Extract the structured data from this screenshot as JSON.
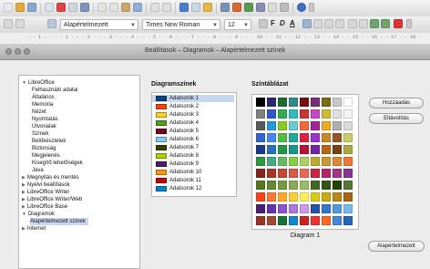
{
  "toolbar": {
    "paragraph_style": "Alapértelmezett",
    "font_name": "Times New Roman",
    "font_size": "12",
    "format_labels": [
      "F",
      "D",
      "A"
    ]
  },
  "ruler": {
    "text": "· · 1 · · · · 1 · · · 2 · · · 3 · · · 4 · · · 5 · · 6 · · · 7 · · · 8 · · · 9 · · · 10 · · 11 · · 12 · · 13 · · 14 · · 15 · · 16 · · 17 · · 18 ·"
  },
  "dialog": {
    "title": "Beállítások – Diagramok – Alapértelmezett színek",
    "tree": [
      {
        "label": "LibreOffice",
        "level": 0,
        "twisty": "▼",
        "selected": false
      },
      {
        "label": "Felhasználó adatai",
        "level": 1,
        "selected": false
      },
      {
        "label": "Általános",
        "level": 1,
        "selected": false
      },
      {
        "label": "Memória",
        "level": 1,
        "selected": false
      },
      {
        "label": "Nézet",
        "level": 1,
        "selected": false
      },
      {
        "label": "Nyomtatás",
        "level": 1,
        "selected": false
      },
      {
        "label": "Útvonalak",
        "level": 1,
        "selected": false
      },
      {
        "label": "Színek",
        "level": 1,
        "selected": false
      },
      {
        "label": "Betűkészletek",
        "level": 1,
        "selected": false
      },
      {
        "label": "Biztonság",
        "level": 1,
        "selected": false
      },
      {
        "label": "Megjelenés",
        "level": 1,
        "selected": false
      },
      {
        "label": "Kisegítő lehetőségek",
        "level": 1,
        "selected": false
      },
      {
        "label": "Java",
        "level": 1,
        "selected": false
      },
      {
        "label": "Megnyitás és mentés",
        "level": 0,
        "twisty": "▶",
        "selected": false
      },
      {
        "label": "Nyelvi beállítások",
        "level": 0,
        "twisty": "▶",
        "selected": false
      },
      {
        "label": "LibreOffice Writer",
        "level": 0,
        "twisty": "▶",
        "selected": false
      },
      {
        "label": "LibreOffice Writer/Web",
        "level": 0,
        "twisty": "▶",
        "selected": false
      },
      {
        "label": "LibreOffice Base",
        "level": 0,
        "twisty": "▶",
        "selected": false
      },
      {
        "label": "Diagramok",
        "level": 0,
        "twisty": "▼",
        "selected": false
      },
      {
        "label": "Alapértelmezett színek",
        "level": 1,
        "selected": true
      },
      {
        "label": "Internet",
        "level": 0,
        "twisty": "▶",
        "selected": false
      }
    ],
    "series_heading": "Diagramszínek",
    "series": [
      {
        "label": "Adatsorok 1",
        "color": "#004586",
        "selected": true
      },
      {
        "label": "Adatsorok 2",
        "color": "#ff420e",
        "selected": false
      },
      {
        "label": "Adatsorok 3",
        "color": "#ffd320",
        "selected": false
      },
      {
        "label": "Adatsorok 4",
        "color": "#579d1c",
        "selected": false
      },
      {
        "label": "Adatsorok 5",
        "color": "#7e0021",
        "selected": false
      },
      {
        "label": "Adatsorok 6",
        "color": "#83caff",
        "selected": false
      },
      {
        "label": "Adatsorok 7",
        "color": "#314004",
        "selected": false
      },
      {
        "label": "Adatsorok 8",
        "color": "#aecf00",
        "selected": false
      },
      {
        "label": "Adatsorok 9",
        "color": "#4b1f6f",
        "selected": false
      },
      {
        "label": "Adatsorok 10",
        "color": "#ff950e",
        "selected": false
      },
      {
        "label": "Adatsorok 11",
        "color": "#c5000b",
        "selected": false
      },
      {
        "label": "Adatsorok 12",
        "color": "#0084d1",
        "selected": false
      }
    ],
    "palette_heading": "Színtáblázat",
    "palette_name": "Diagram 1",
    "palette_colors": [
      "#000000",
      "#2a2a6e",
      "#1e6b2e",
      "#2e8a8a",
      "#7a1010",
      "#7a2a7a",
      "#7a6a10",
      "#c8c8c8",
      "#ffffff",
      "#808080",
      "#3355cc",
      "#33aa55",
      "#33bbbb",
      "#cc3333",
      "#cc44cc",
      "#ccbb33",
      "#e0e0e0",
      "#f4f4f4",
      "#5a5a5a",
      "#2299dd",
      "#88cc22",
      "#66cccc",
      "#ff6633",
      "#aa2299",
      "#eeaa22",
      "#b0b0b0",
      "#dadada",
      "#3366cc",
      "#4488ee",
      "#55bb44",
      "#22aa99",
      "#dd2244",
      "#9933cc",
      "#cc8822",
      "#995522",
      "#cccc66",
      "#1a3a8a",
      "#2a70c0",
      "#229944",
      "#119988",
      "#bb1133",
      "#7722aa",
      "#bb6611",
      "#774411",
      "#aaaa44",
      "#2a9a3a",
      "#44aa88",
      "#66bb66",
      "#88cc44",
      "#aad066",
      "#bbaa33",
      "#cc9933",
      "#dd8833",
      "#ee7733",
      "#882222",
      "#aa3322",
      "#cc4433",
      "#dd5544",
      "#ee6655",
      "#cc2244",
      "#bb2266",
      "#aa3388",
      "#883399",
      "#557722",
      "#668833",
      "#779944",
      "#88aa55",
      "#99bb66",
      "#446622",
      "#335511",
      "#224400",
      "#557733",
      "#ff4411",
      "#ff7733",
      "#ffaa22",
      "#ffcc33",
      "#ffee55",
      "#ddcc11",
      "#ccaa11",
      "#bb8811",
      "#aa6611",
      "#4b1f6f",
      "#6633aa",
      "#8855cc",
      "#aa77dd",
      "#cc99ee",
      "#2255aa",
      "#3377cc",
      "#5599dd",
      "#77bbee",
      "#993322",
      "#aa4433",
      "#117733",
      "#1188cc",
      "#cc2222",
      "#ee3333",
      "#ff6622",
      "#4488dd",
      "#2266bb"
    ],
    "buttons": {
      "add": "Hozzáadás",
      "remove": "Eltávolítás",
      "default": "Alapértelmezett"
    }
  }
}
